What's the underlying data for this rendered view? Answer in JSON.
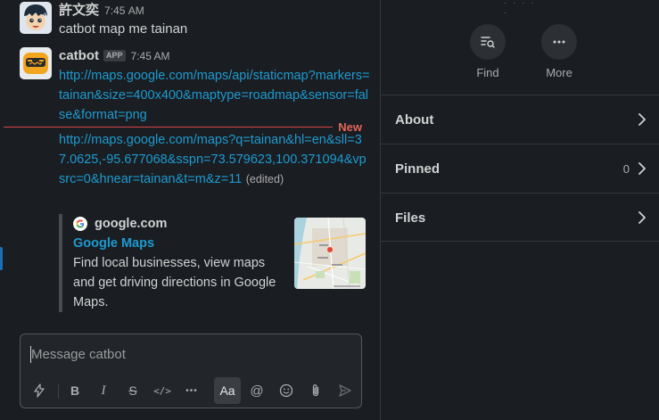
{
  "messages": [
    {
      "author": "許文奕",
      "time": "7:45 AM",
      "text": "catbot map me tainan"
    },
    {
      "author": "catbot",
      "badge": "APP",
      "time": "7:45 AM",
      "link1": "http://maps.google.com/maps/api/staticmap?markers=tainan&size=400x400&maptype=roadmap&sensor=false&format=png",
      "link2": "http://maps.google.com/maps?q=tainan&hl=en&sll=37.0625,-95.677068&sspn=73.579623,100.371094&vpsrc=0&hnear=tainan&t=m&z=11",
      "edited": "(edited)"
    }
  ],
  "divider": {
    "label": "New",
    "color": "#e2665a"
  },
  "unfurl": {
    "site": "google.com",
    "title": "Google Maps",
    "description": "Find local businesses, view maps and get driving directions in Google Maps.",
    "thumb_icon": "map-thumbnail"
  },
  "composer": {
    "placeholder": "Message catbot",
    "toolbar": [
      {
        "name": "shortcuts-icon",
        "label": "⚡"
      },
      {
        "name": "bold-icon",
        "label": "B"
      },
      {
        "name": "italic-icon",
        "label": "I"
      },
      {
        "name": "strikethrough-icon",
        "label": "S"
      },
      {
        "name": "code-icon",
        "label": "</>"
      },
      {
        "name": "more-formatting-icon",
        "label": "•••"
      },
      {
        "name": "formatting-toggle",
        "label": "Aa"
      },
      {
        "name": "mention-icon",
        "label": "@"
      },
      {
        "name": "emoji-icon",
        "label": "☺"
      },
      {
        "name": "attach-icon",
        "label": "📎"
      },
      {
        "name": "send-icon",
        "label": "➤"
      }
    ]
  },
  "details": {
    "actions": [
      {
        "label": "Find",
        "icon": "find-icon"
      },
      {
        "label": "More",
        "icon": "more-icon"
      }
    ],
    "rows": [
      {
        "label": "About",
        "count": ""
      },
      {
        "label": "Pinned",
        "count": "0"
      },
      {
        "label": "Files",
        "count": ""
      }
    ]
  },
  "colors": {
    "background": "#1a1d21",
    "link": "#1d9bd1",
    "new_divider": "#d6464a",
    "left_marker": "#1d6fb5"
  }
}
